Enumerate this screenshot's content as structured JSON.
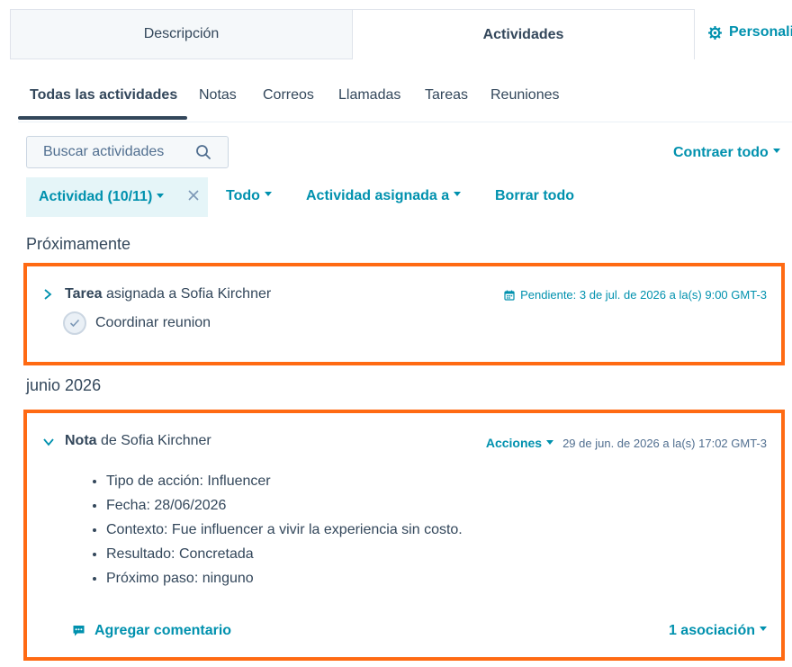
{
  "top_tabs": {
    "description": "Descripción",
    "activities": "Actividades",
    "personalize": "Personali"
  },
  "sub_tabs": [
    "Todas las actividades",
    "Notas",
    "Correos",
    "Llamadas",
    "Tareas",
    "Reuniones"
  ],
  "search": {
    "placeholder": "Buscar actividades"
  },
  "collapse_all": "Contraer todo",
  "filters": {
    "activity": "Actividad (10/11)",
    "all": "Todo",
    "assigned": "Actividad asignada a",
    "clear": "Borrar todo"
  },
  "sections": {
    "upcoming": "Próximamente",
    "month": "junio 2026"
  },
  "task_card": {
    "type": "Tarea",
    "rest": " asignada a Sofia Kirchner",
    "due": "Pendiente: 3 de jul. de 2026 a la(s) 9:00 GMT-3",
    "task_name": "Coordinar reunion"
  },
  "note_card": {
    "type": "Nota",
    "rest": " de Sofia Kirchner",
    "actions": "Acciones",
    "date": "29 de jun. de 2026 a la(s) 17:02 GMT-3",
    "bullets": [
      "Tipo de acción: Influencer",
      "Fecha: 28/06/2026",
      "Contexto: Fue influencer a vivir la experiencia sin costo.",
      "Resultado: Concretada",
      "Próximo paso: ninguno"
    ],
    "add_comment": "Agregar comentario",
    "associations": "1 asociación"
  },
  "colors": {
    "accent": "#0091ae",
    "highlight": "#ff6a13",
    "text": "#33475b"
  }
}
